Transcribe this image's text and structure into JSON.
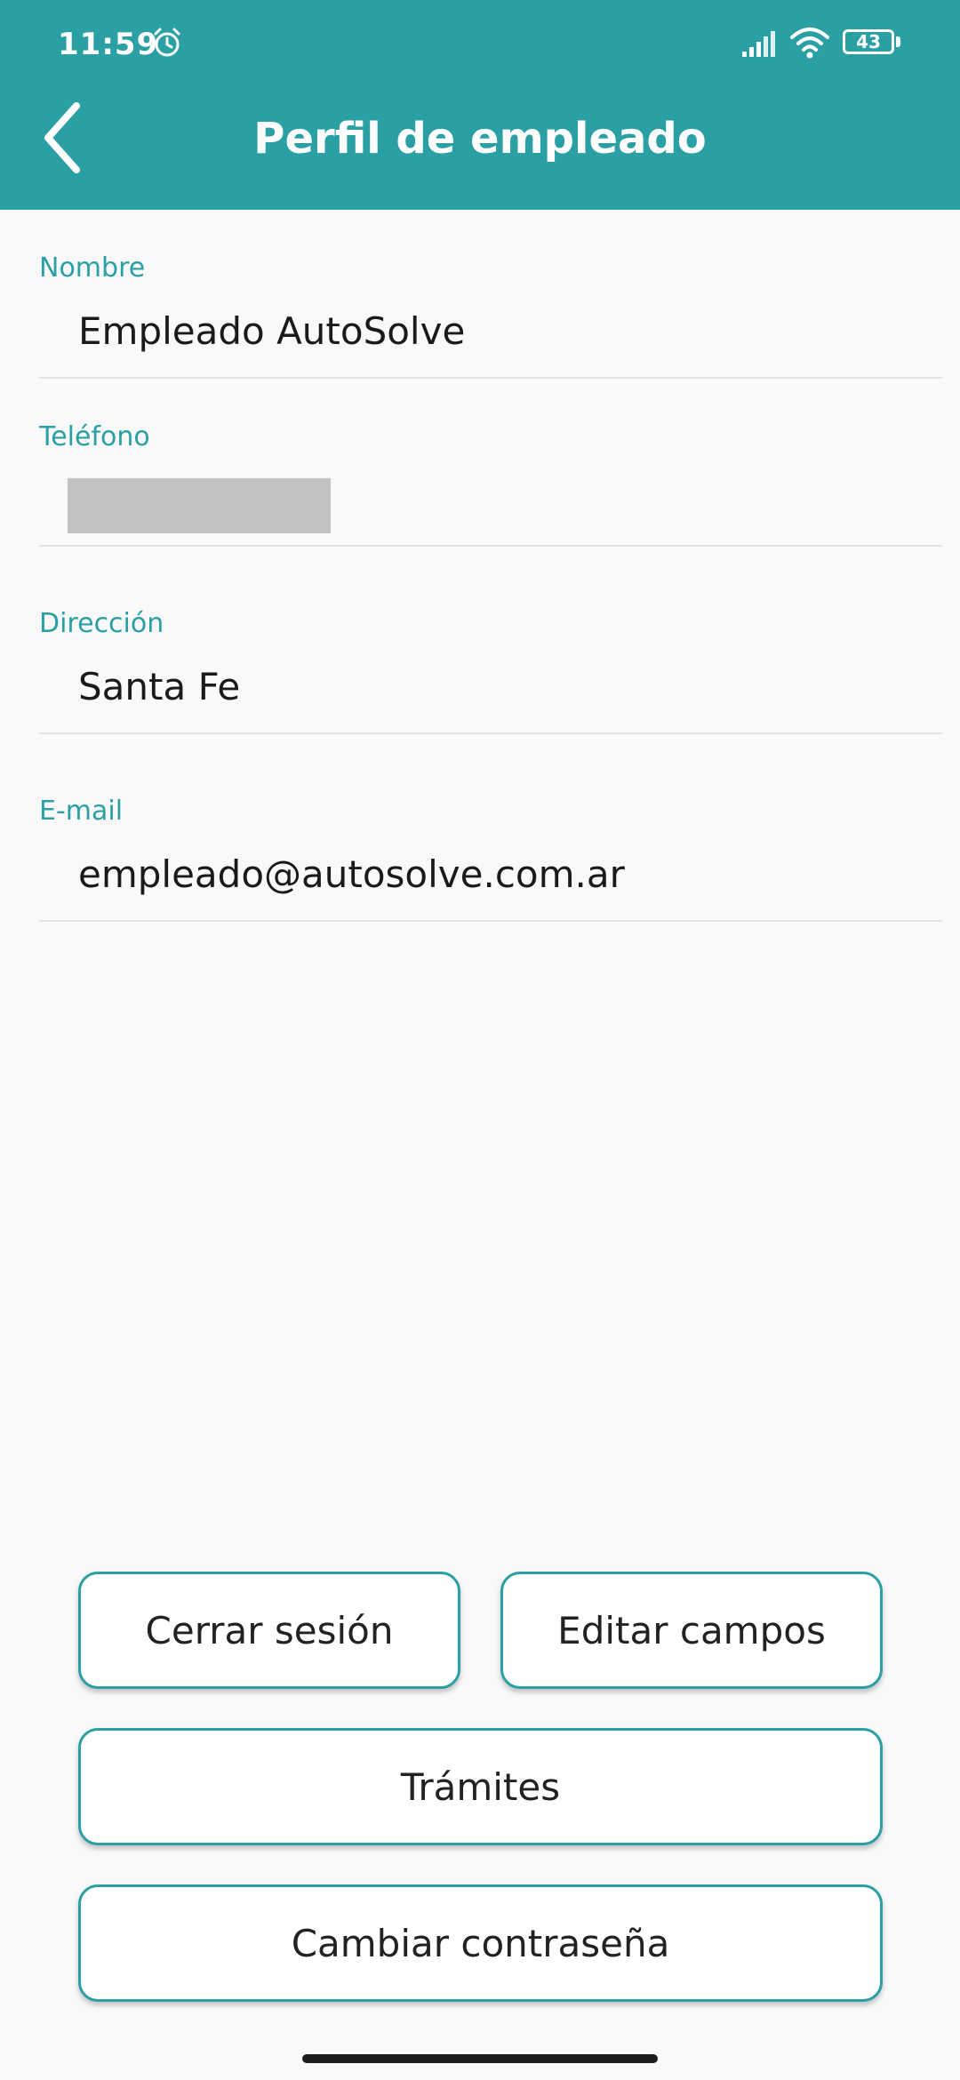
{
  "status_bar": {
    "time": "11:59",
    "battery_level": "43",
    "icons": [
      "alarm-icon",
      "signal-icon",
      "wifi-icon",
      "battery-icon"
    ]
  },
  "header": {
    "title": "Perfil de empleado",
    "back_icon": "chevron-left-icon"
  },
  "fields": [
    {
      "label": "Nombre",
      "value": "Empleado AutoSolve"
    },
    {
      "label": "Teléfono",
      "value": ""
    },
    {
      "label": "Dirección",
      "value": "Santa Fe"
    },
    {
      "label": "E-mail",
      "value": "empleado@autosolve.com.ar"
    }
  ],
  "buttons": {
    "logout": "Cerrar sesión",
    "edit_fields": "Editar campos",
    "procedures": "Trámites",
    "change_password": "Cambiar contraseña"
  },
  "colors": {
    "accent": "#2aa0a4",
    "background": "#f9f9f9",
    "text": "#1a1a1a"
  }
}
